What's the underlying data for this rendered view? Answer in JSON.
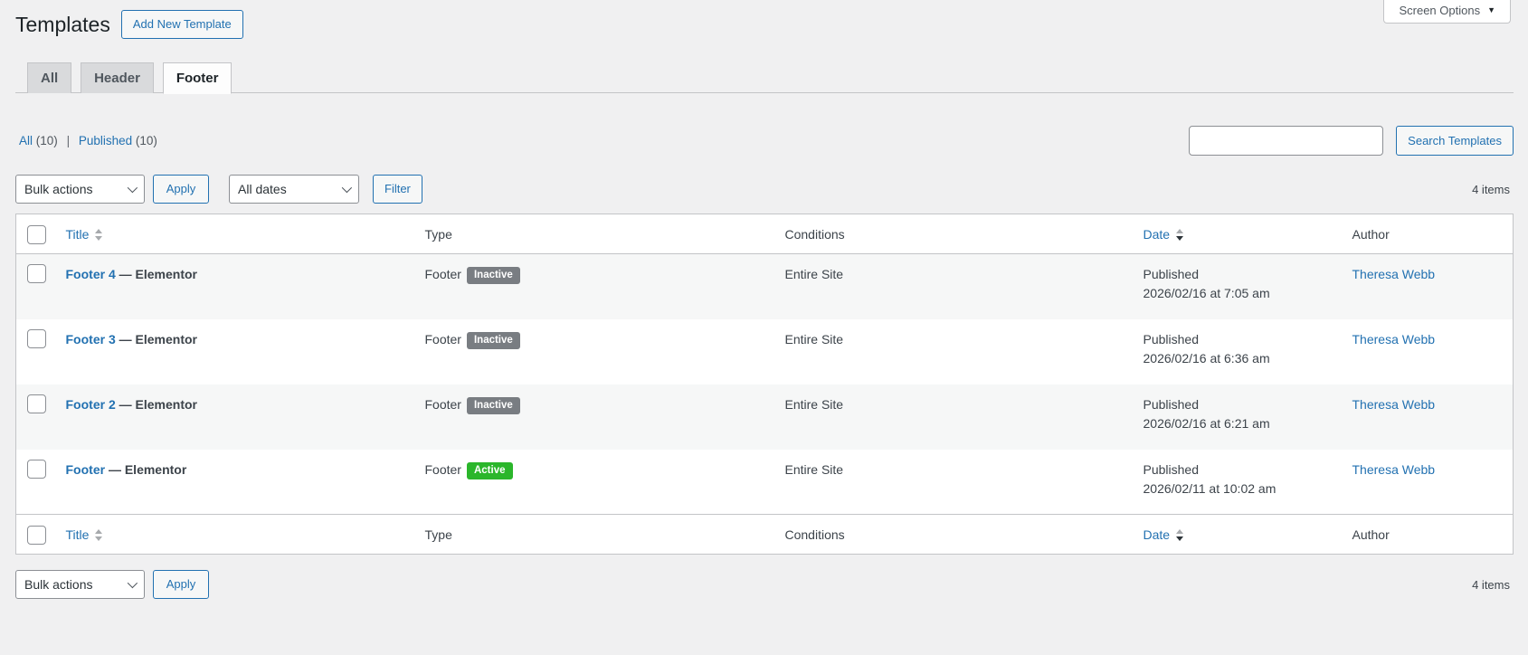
{
  "page": {
    "title": "Templates",
    "add_new_label": "Add New Template",
    "screen_options_label": "Screen Options"
  },
  "icons": {
    "screen_options_caret": "▼"
  },
  "tabs": [
    {
      "label": "All",
      "active": false
    },
    {
      "label": "Header",
      "active": false
    },
    {
      "label": "Footer",
      "active": true
    }
  ],
  "filter_links": {
    "all_label": "All",
    "all_count": "(10)",
    "separator": "|",
    "published_label": "Published",
    "published_count": "(10)"
  },
  "search": {
    "value": "",
    "button_label": "Search Templates"
  },
  "toolbar": {
    "bulk_actions": "Bulk actions",
    "apply": "Apply",
    "all_dates": "All dates",
    "filter": "Filter",
    "items_count": "4 items"
  },
  "table": {
    "columns": {
      "title": "Title",
      "type": "Type",
      "conditions": "Conditions",
      "date": "Date",
      "author": "Author"
    },
    "sort_state": {
      "title": "unsorted",
      "date": "descending"
    },
    "rows": [
      {
        "title": "Footer 4",
        "state": "— Elementor",
        "type": "Footer",
        "badge": "Inactive",
        "conditions": "Entire Site",
        "status": "Published",
        "date": "2026/02/16 at 7:05 am",
        "author": "Theresa Webb"
      },
      {
        "title": "Footer 3",
        "state": "— Elementor",
        "type": "Footer",
        "badge": "Inactive",
        "conditions": "Entire Site",
        "status": "Published",
        "date": "2026/02/16 at 6:36 am",
        "author": "Theresa Webb"
      },
      {
        "title": "Footer 2",
        "state": "— Elementor",
        "type": "Footer",
        "badge": "Inactive",
        "conditions": "Entire Site",
        "status": "Published",
        "date": "2026/02/16 at 6:21 am",
        "author": "Theresa Webb"
      },
      {
        "title": "Footer",
        "state": "— Elementor",
        "type": "Footer",
        "badge": "Active",
        "conditions": "Entire Site",
        "status": "Published",
        "date": "2026/02/11 at 10:02 am",
        "author": "Theresa Webb"
      }
    ]
  },
  "colors": {
    "accent_blue": "#2271b1",
    "active_badge_green": "#2bb62b",
    "inactive_badge_gray": "#797d82",
    "page_background": "#f0f0f1"
  }
}
